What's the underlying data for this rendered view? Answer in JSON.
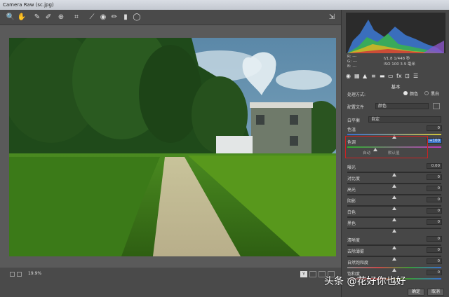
{
  "window": {
    "title": "Camera Raw (sc.jpg)"
  },
  "toolbar": {
    "tools": [
      {
        "icon": "zoom-icon",
        "glyph": "🔍"
      },
      {
        "icon": "hand-icon",
        "glyph": "✋"
      },
      {
        "icon": "eyedropper-icon",
        "glyph": "✎"
      },
      {
        "icon": "color-sampler-icon",
        "glyph": "✐"
      },
      {
        "icon": "target-icon",
        "glyph": "⊕"
      },
      {
        "icon": "crop-icon",
        "glyph": "⌗"
      },
      {
        "icon": "straighten-icon",
        "glyph": "⟋"
      },
      {
        "icon": "red-eye-icon",
        "glyph": "◉"
      },
      {
        "icon": "brush-icon",
        "glyph": "✏"
      },
      {
        "icon": "graduated-filter-icon",
        "glyph": "▮"
      },
      {
        "icon": "radial-filter-icon",
        "glyph": "◯"
      }
    ],
    "fullscreen_icon": "export-icon"
  },
  "status": {
    "zoom": "19.9%"
  },
  "panel": {
    "rgb": {
      "r": "R:",
      "g": "G:",
      "b": "B:",
      "dash": "---"
    },
    "camera_info": {
      "line1": "f/1.8  1/448 秒",
      "line2": "ISO 100   3.9 毫米"
    },
    "section_title": "基本",
    "treatment_label": "处理方式:",
    "treatment_color": "颜色",
    "treatment_bw": "黑白",
    "profile_label": "配置文件",
    "profile_value": "颜色",
    "wb_label": "白平衡",
    "wb_value": "自定",
    "sliders": [
      {
        "label": "色温",
        "value": "0",
        "pos": 0.5
      },
      {
        "label": "色调",
        "value": "+100",
        "pos": 0.3
      },
      {
        "label": "曝光",
        "value": "0.00",
        "pos": 0.5
      },
      {
        "label": "对比度",
        "value": "0",
        "pos": 0.5
      },
      {
        "label": "高光",
        "value": "0",
        "pos": 0.5
      },
      {
        "label": "阴影",
        "value": "0",
        "pos": 0.5
      },
      {
        "label": "白色",
        "value": "0",
        "pos": 0.5
      },
      {
        "label": "黑色",
        "value": "0",
        "pos": 0.5
      },
      {
        "label": "清晰度",
        "value": "0",
        "pos": 0.5
      },
      {
        "label": "去除薄雾",
        "value": "0",
        "pos": 0.5
      },
      {
        "label": "自然饱和度",
        "value": "0",
        "pos": 0.5
      },
      {
        "label": "饱和度",
        "value": "0",
        "pos": 0.5
      }
    ],
    "auto_label": "自动",
    "default_label": "默认值",
    "ok_button": "确定",
    "cancel_button": "取消"
  },
  "watermark": "头条 @花好你也好",
  "colors": {
    "accent": "#cc2222",
    "panel_bg": "#474747",
    "selection": "#3a74c8"
  }
}
